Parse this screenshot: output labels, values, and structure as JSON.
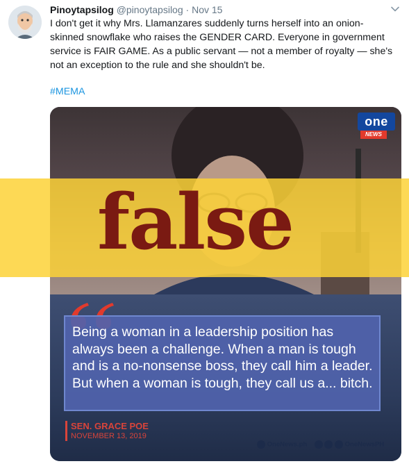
{
  "tweet": {
    "display_name": "Pinoytapsilog",
    "handle": "@pinoytapsilog",
    "separator": "·",
    "date": "Nov 15",
    "text": "I don't get it why Mrs. Llamanzares suddenly turns herself into an onion-skinned snowflake who raises the GENDER CARD. Everyone in government service is FAIR GAME. As a public servant — not a member of royalty — she's not an exception to the rule and she shouldn't be.",
    "hashtag": "#MEMA"
  },
  "media": {
    "logo_text": "one",
    "logo_tag": "NEWS",
    "verdict": "false",
    "quote": "Being a woman in a leadership position has always been a challenge. When a man is tough and is a no-nonsense boss, they call him a leader. But when a woman is tough, they call us a... bitch.",
    "speaker": "SEN. GRACE POE",
    "speaker_date": "NOVEMBER 13, 2019",
    "footer_site": "OneNews.ph",
    "footer_social": "OneNewsPH"
  },
  "colors": {
    "verdict_band": "#fdd237",
    "verdict_text": "#7a1a12",
    "quote_box": "#5063ac",
    "quote_mark": "#e23a2c",
    "link": "#1b95e0"
  }
}
